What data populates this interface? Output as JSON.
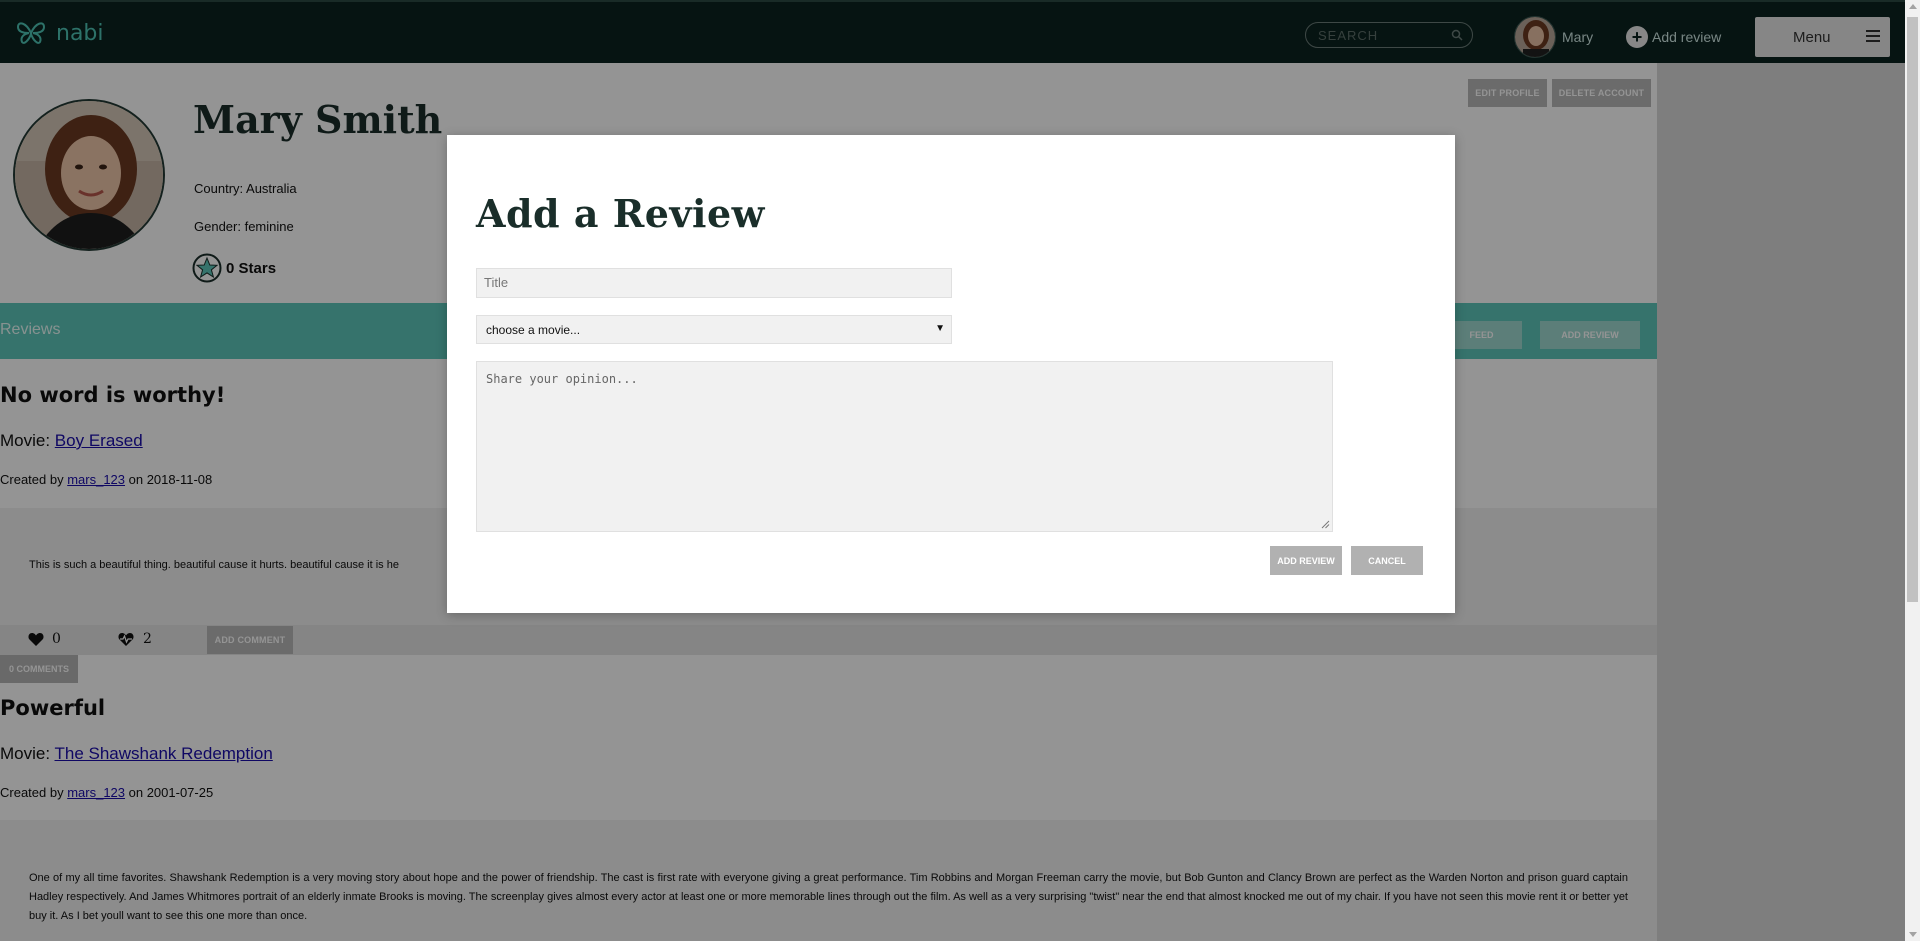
{
  "navbar": {
    "brand": "nabi",
    "search_placeholder": "SEARCH",
    "user_name": "Mary",
    "add_review_label": "Add review",
    "menu_label": "Menu"
  },
  "profile": {
    "name": "Mary Smith",
    "country": "Country: Australia",
    "gender": "Gender: feminine",
    "stars": "0 Stars",
    "edit_label": "EDIT PROFILE",
    "delete_label": "DELETE ACCOUNT"
  },
  "reviews_bar": {
    "title": "Reviews",
    "feed_label": "FEED",
    "add_review_label": "ADD REVIEW"
  },
  "reviews": [
    {
      "title": "No word is worthy!",
      "movie_prefix": "Movie: ",
      "movie": "Boy Erased",
      "created_prefix": "Created by ",
      "author": "mars_123",
      "date_text": " on 2018-11-08",
      "body": "This is such a beautiful thing. beautiful cause it hurts. beautiful cause it is he",
      "likes": "0",
      "hearts": "2",
      "add_comment_label": "ADD COMMENT",
      "comments_label": "0 COMMENTS"
    },
    {
      "title": "Powerful",
      "movie_prefix": "Movie: ",
      "movie": "The Shawshank Redemption",
      "created_prefix": "Created by ",
      "author": "mars_123",
      "date_text": " on 2001-07-25",
      "body": "One of my all time favorites. Shawshank Redemption is a very moving story about hope and the power of friendship. The cast is first rate with everyone giving a great performance. Tim Robbins and Morgan Freeman carry the movie, but Bob Gunton and Clancy Brown are perfect as the Warden Norton and prison guard captain Hadley respectively. And James Whitmores portrait of an elderly inmate Brooks is moving. The screenplay gives almost every actor at least one or more memorable lines through out the film. As well as a very surprising \"twist\" near the end that almost knocked me out of my chair. If you have not seen this movie rent it or better yet buy it. As I bet youll want to see this one more than once."
    }
  ],
  "modal": {
    "title": "Add a Review",
    "title_placeholder": "Title",
    "movie_select": "choose a movie...",
    "opinion_placeholder": "Share your opinion...",
    "submit_label": "ADD REVIEW",
    "cancel_label": "CANCEL"
  },
  "colors": {
    "navbar": "#0c2420",
    "brand": "#4fc5b6",
    "reviews_bar": "#5ec7bb",
    "heading": "#1a2e2a",
    "link": "#1a0dab"
  }
}
